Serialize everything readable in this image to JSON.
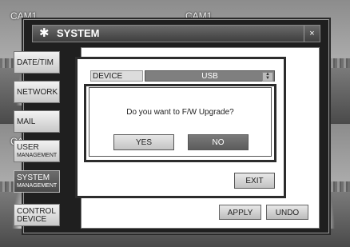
{
  "camera_labels": [
    "CAM1",
    "CAM1",
    "CA"
  ],
  "window": {
    "title": "SYSTEM",
    "close_label": "×"
  },
  "sidebar": [
    {
      "line1": "DATE/TIM",
      "line2": ""
    },
    {
      "line1": "NETWORK",
      "line2": ""
    },
    {
      "line1": "MAIL",
      "line2": ""
    },
    {
      "line1": "USER",
      "line2": "MANAGEMENT"
    },
    {
      "line1": "SYSTEM",
      "line2": "MANAGEMENT"
    },
    {
      "line1": "CONTROL",
      "line2": "DEVICE"
    }
  ],
  "device": {
    "label": "DEVICE",
    "value": "USB"
  },
  "dialog": {
    "message": "Do you want to F/W Upgrade?",
    "yes_label": "YES",
    "no_label": "NO"
  },
  "buttons": {
    "exit": "EXIT",
    "apply": "APPLY",
    "undo": "UNDO"
  }
}
